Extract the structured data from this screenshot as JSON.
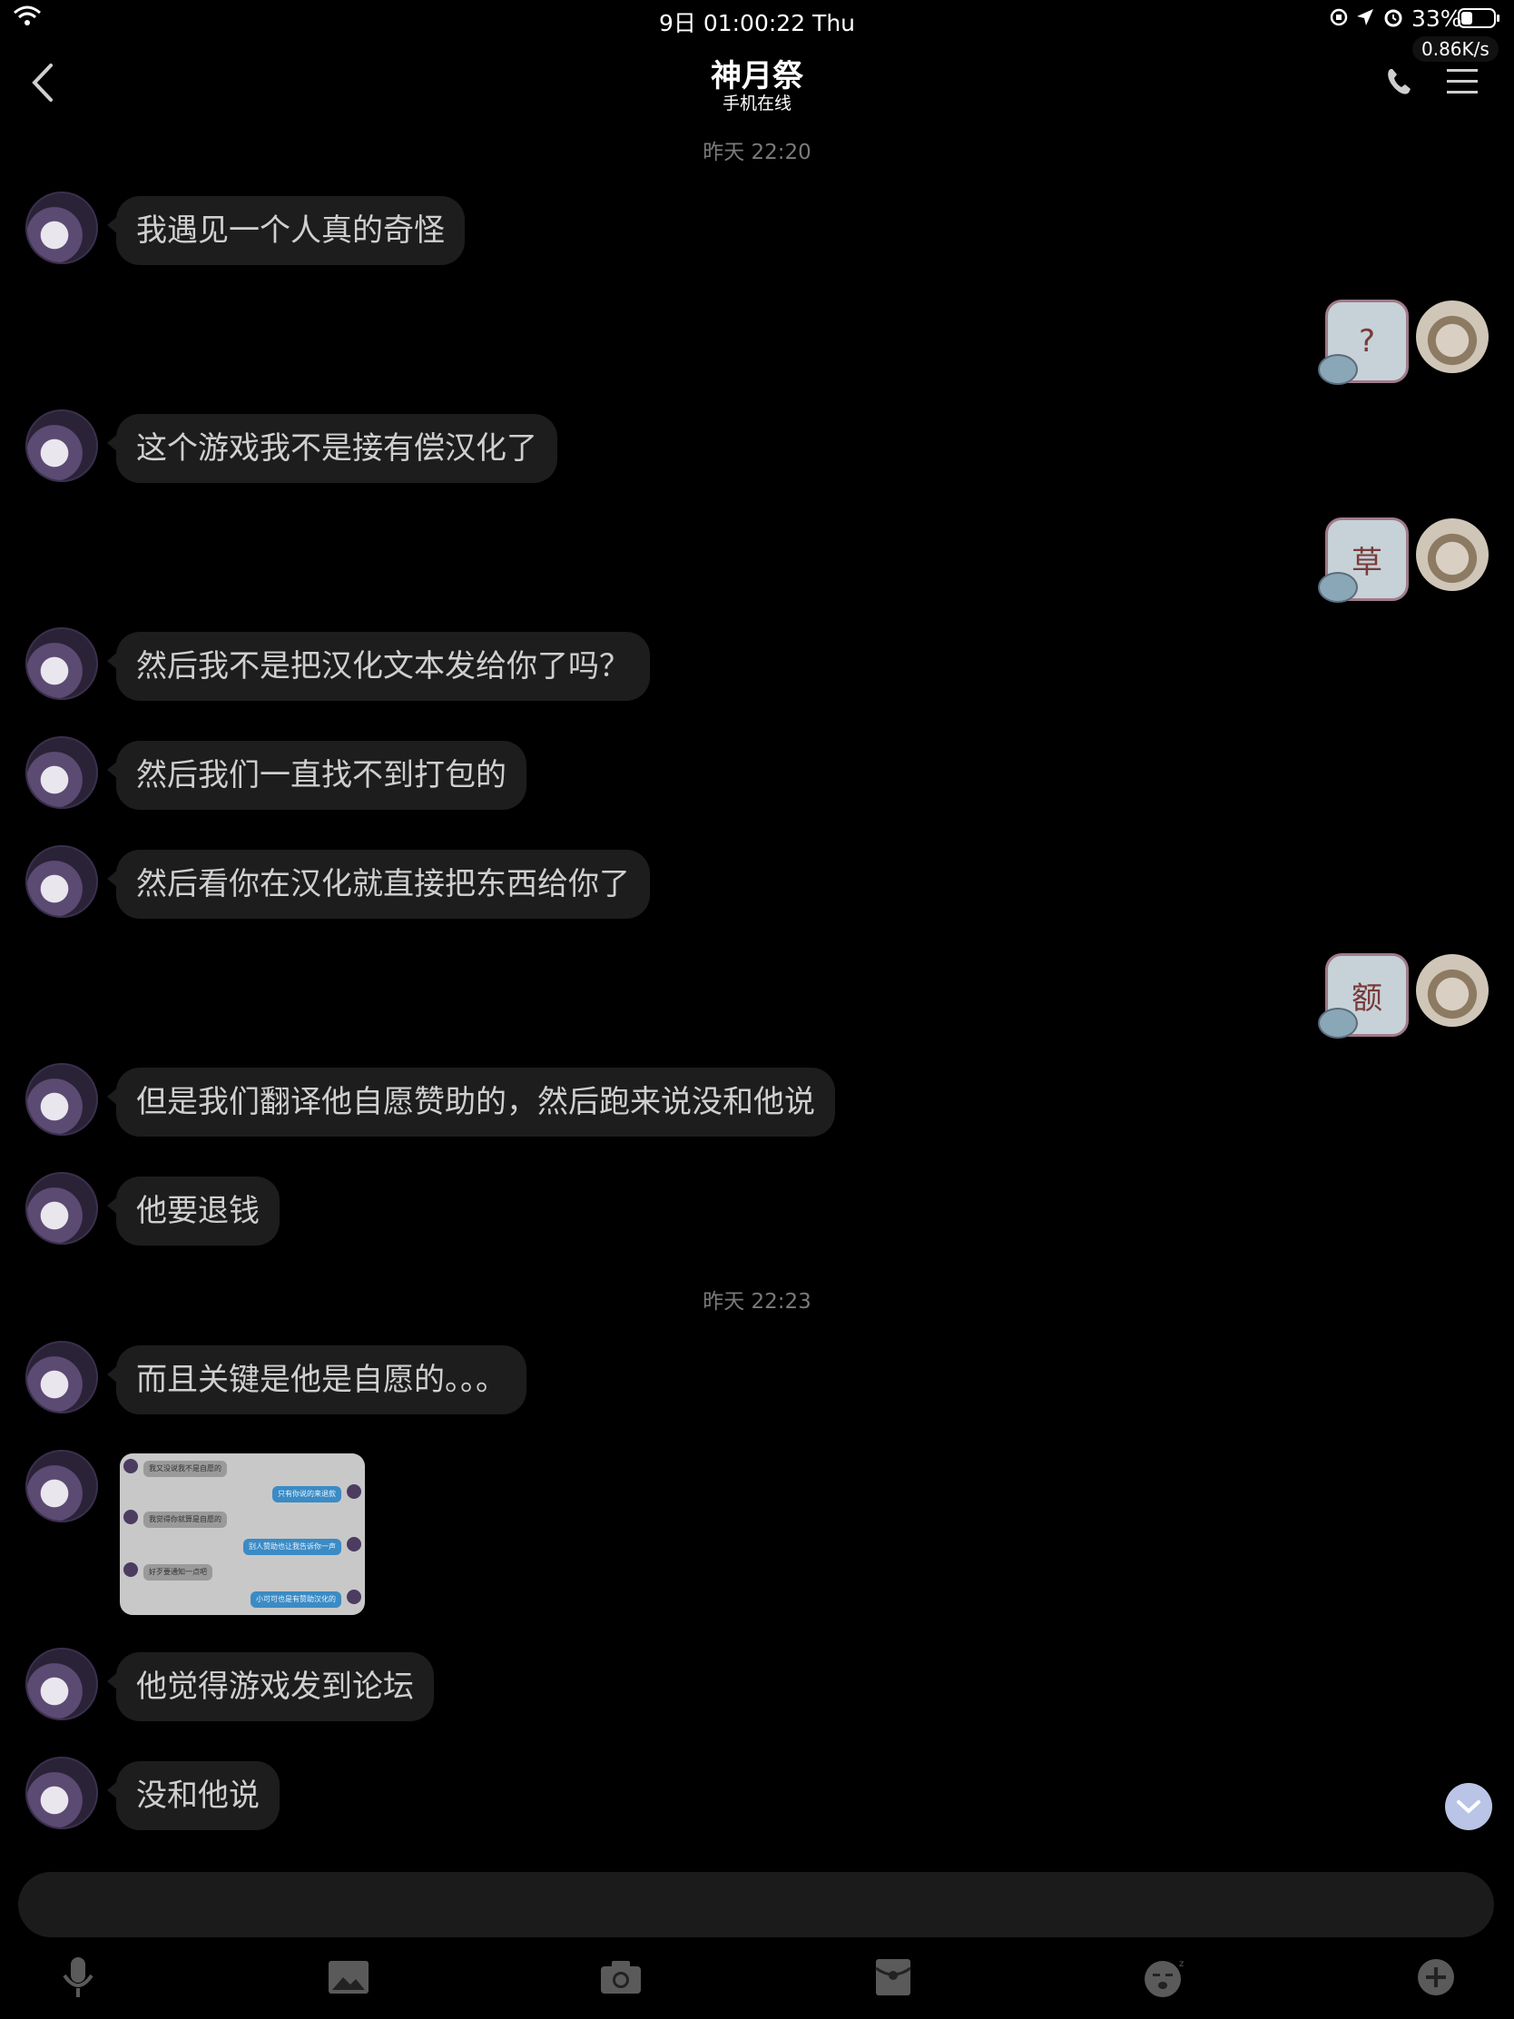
{
  "status_bar": {
    "time": "9日 01:00:22 Thu",
    "battery": "33%",
    "net_speed": "0.86K/s"
  },
  "header": {
    "name": "神月祭",
    "status": "手机在线"
  },
  "timestamps": [
    "昨天 22:20",
    "昨天 22:23"
  ],
  "messages": [
    {
      "side": "left",
      "text": "我遇见一个人真的奇怪"
    },
    {
      "side": "right",
      "sticker": "?"
    },
    {
      "side": "left",
      "text": "这个游戏我不是接有偿汉化了"
    },
    {
      "side": "right",
      "sticker": "草"
    },
    {
      "side": "left",
      "text": "然后我不是把汉化文本发给你了吗？"
    },
    {
      "side": "left",
      "text": "然后我们一直找不到打包的"
    },
    {
      "side": "left",
      "text": "然后看你在汉化就直接把东西给你了"
    },
    {
      "side": "right",
      "sticker": "额"
    },
    {
      "side": "left",
      "text": "但是我们翻译他自愿赞助的，然后跑来说没和他说"
    },
    {
      "side": "left",
      "text": "他要退钱"
    },
    {
      "side": "left",
      "text": "而且关键是他是自愿的。。。"
    },
    {
      "side": "left",
      "image": true
    },
    {
      "side": "left",
      "text": "他觉得游戏发到论坛"
    },
    {
      "side": "left",
      "text": "没和他说"
    }
  ],
  "image_preview": [
    {
      "side": "left",
      "text": "我又没说我不是自愿的"
    },
    {
      "side": "right",
      "text": "只有你说的来退款"
    },
    {
      "side": "left",
      "text": "我觉得你就算是自愿的"
    },
    {
      "side": "right",
      "text": "别人赞助也让我告诉你一声"
    },
    {
      "side": "left",
      "text": "好歹要通知一点吧"
    },
    {
      "side": "right",
      "text": "小可可也是有赞助汉化的"
    }
  ],
  "input": {
    "placeholder": ""
  },
  "toolbar": [
    "mic-icon",
    "image-icon",
    "camera-icon",
    "red-packet-icon",
    "emoji-icon",
    "plus-icon"
  ],
  "colors": {
    "bubble": "#1d1d1d",
    "background": "#000000",
    "timestamp": "#7a7a7a"
  }
}
